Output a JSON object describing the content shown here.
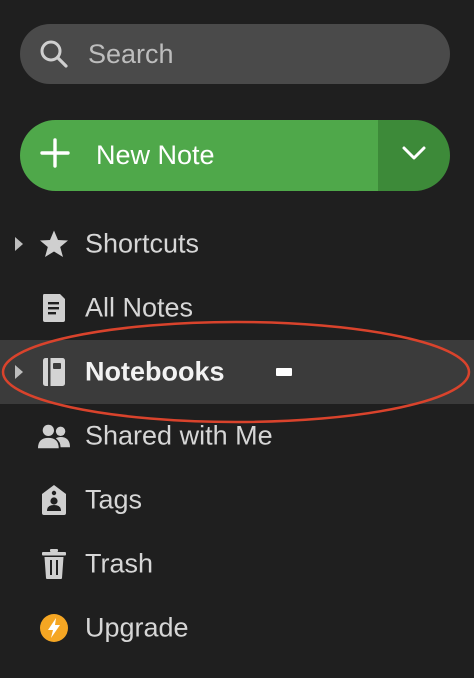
{
  "search": {
    "placeholder": "Search"
  },
  "new_note": {
    "label": "New Note"
  },
  "nav": {
    "items": [
      {
        "id": "shortcuts",
        "label": "Shortcuts",
        "icon": "star-icon",
        "expandable": true,
        "selected": false
      },
      {
        "id": "all-notes",
        "label": "All Notes",
        "icon": "note-icon",
        "expandable": false,
        "selected": false
      },
      {
        "id": "notebooks",
        "label": "Notebooks",
        "icon": "notebook-icon",
        "expandable": true,
        "selected": true
      },
      {
        "id": "shared",
        "label": "Shared with Me",
        "icon": "people-icon",
        "expandable": false,
        "selected": false
      },
      {
        "id": "tags",
        "label": "Tags",
        "icon": "tag-icon",
        "expandable": false,
        "selected": false
      },
      {
        "id": "trash",
        "label": "Trash",
        "icon": "trash-icon",
        "expandable": false,
        "selected": false
      },
      {
        "id": "upgrade",
        "label": "Upgrade",
        "icon": "lightning-icon",
        "expandable": false,
        "selected": false
      }
    ]
  },
  "colors": {
    "background": "#1f1f1f",
    "search_bg": "#4a4a4a",
    "accent_green": "#4fa84a",
    "accent_green_dark": "#3d8a39",
    "selected_row": "#3b3b3b",
    "upgrade_icon": "#f5a623",
    "annotation_ellipse": "#d9432c"
  }
}
